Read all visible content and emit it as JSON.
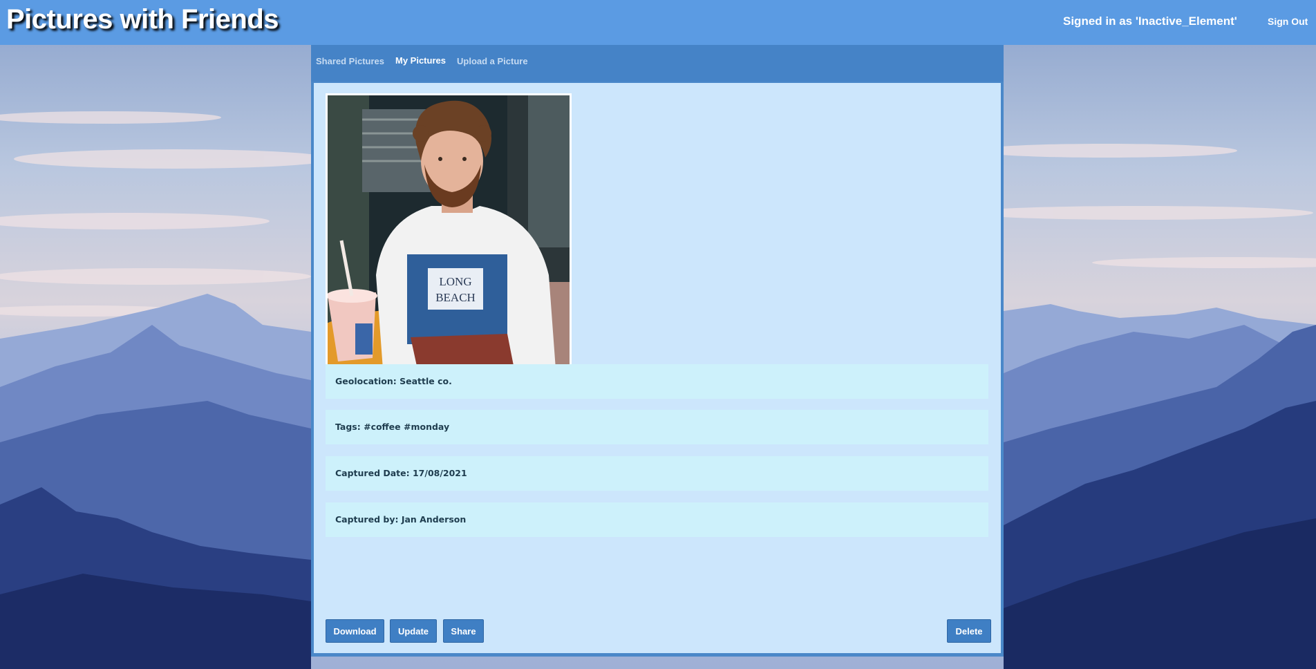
{
  "header": {
    "title": "Pictures with Friends",
    "signed_in_text": "Signed in as 'Inactive_Element'",
    "sign_out_label": "Sign Out"
  },
  "nav": {
    "tabs": [
      {
        "label": "Shared Pictures",
        "active": false
      },
      {
        "label": "My Pictures",
        "active": true
      },
      {
        "label": "Upload a Picture",
        "active": false
      }
    ]
  },
  "picture": {
    "shirt_text_line1": "LONG",
    "shirt_text_line2": "BEACH",
    "details": [
      {
        "text": "Geolocation: Seattle co."
      },
      {
        "text": "Tags: #coffee #monday"
      },
      {
        "text": "Captured Date: 17/08/2021"
      },
      {
        "text": "Captured by: Jan Anderson"
      }
    ]
  },
  "actions": {
    "download_label": "Download",
    "update_label": "Update",
    "share_label": "Share",
    "delete_label": "Delete"
  },
  "colors": {
    "header_bg": "#5b9be3",
    "panel_bg": "#4a88c9",
    "content_bg": "#cce6fc",
    "info_row_bg": "#cdf1fb",
    "button_bg": "#3f7fc4"
  }
}
